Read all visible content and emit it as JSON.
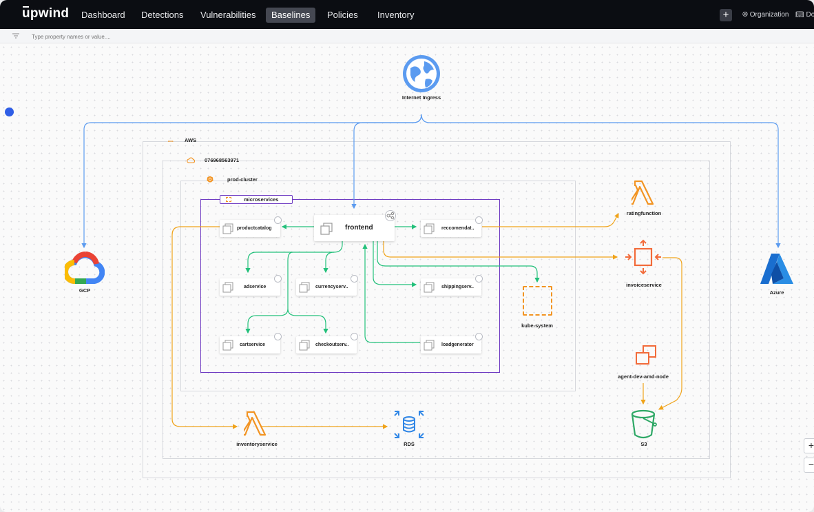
{
  "brand": {
    "name": "upwind"
  },
  "nav": {
    "items": [
      {
        "label": "Dashboard"
      },
      {
        "label": "Detections"
      },
      {
        "label": "Vulnerabilities"
      },
      {
        "label": "Baselines",
        "active": true
      },
      {
        "label": "Policies"
      },
      {
        "label": "Inventory"
      }
    ],
    "plus": "+",
    "organization": "Organization",
    "docs": "Doc"
  },
  "filter": {
    "placeholder": "Type property names or value...."
  },
  "graph": {
    "external": {
      "internet": "Internet Ingress",
      "gcp": "GCP",
      "azure": "Azure"
    },
    "groups": {
      "aws": "AWS",
      "account": "076968563971",
      "cluster": "prod-cluster",
      "namespace": "microservices"
    },
    "services": {
      "frontend": "frontend",
      "productcatalog": "productcatalog",
      "reccomendation": "reccomendat..",
      "adservice": "adservice",
      "currency": "currencyserv..",
      "shipping": "shippingserv..",
      "cartservice": "cartservice",
      "checkout": "checkoutserv..",
      "loadgenerator": "loadgenerator"
    },
    "nodes": {
      "kube_system": "kube-system",
      "ratingfunction": "ratingfunction",
      "invoiceservice": "invoiceservice",
      "agent": "agent-dev-amd-node",
      "inventoryservice": "inventoryservice",
      "rds": "RDS",
      "s3": "S3"
    },
    "colors": {
      "blue": "#5b9bf0",
      "green": "#22c07a",
      "orange": "#f0a31a",
      "purple": "#6f3cc2",
      "aws_orange": "#f29423",
      "red_orange": "#f26b3a"
    }
  },
  "zoom": {
    "in": "+",
    "out": "−"
  }
}
